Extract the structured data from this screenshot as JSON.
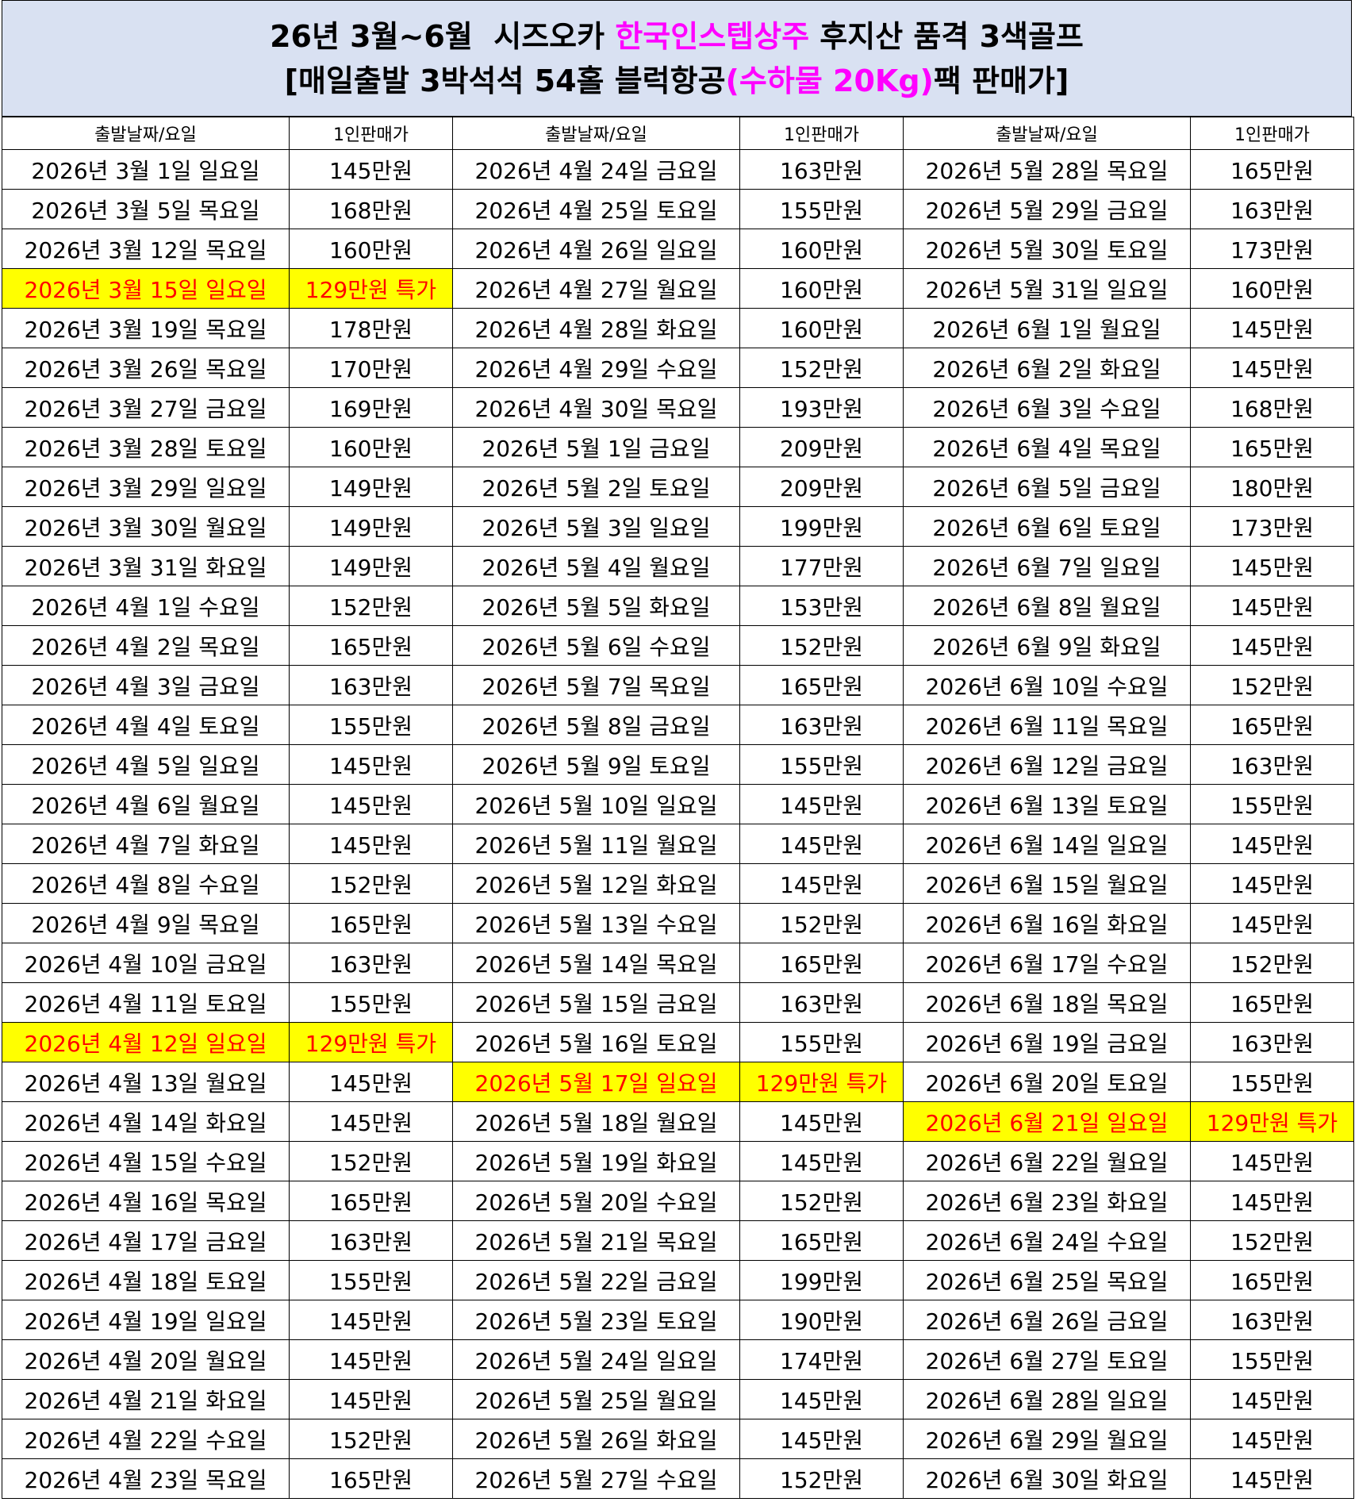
{
  "title": {
    "line1_pre": "26년 3월~6월  시즈오카 ",
    "line1_hl": "한국인스텝상주",
    "line1_post": " 후지산 품격 3색골프",
    "line2_pre": "[매일출발 3박석석 54홀 블럭항공",
    "line2_hl": "(수하물 20Kg)",
    "line2_post": "팩 판매가]"
  },
  "colors": {
    "header_bg": "#d9e1f2",
    "highlight_bg": "#ffff00",
    "highlight_text": "#ff0000",
    "title_accent": "#ff00ff"
  },
  "headers": [
    "출발날짜/요일",
    "1인판매가",
    "출발날짜/요일",
    "1인판매가",
    "출발날짜/요일",
    "1인판매가"
  ],
  "rows": [
    [
      {
        "d": "2026년 3월 1일 일요일",
        "p": "145만원"
      },
      {
        "d": "2026년 4월 24일 금요일",
        "p": "163만원"
      },
      {
        "d": "2026년 5월 28일 목요일",
        "p": "165만원"
      }
    ],
    [
      {
        "d": "2026년 3월 5일 목요일",
        "p": "168만원"
      },
      {
        "d": "2026년 4월 25일 토요일",
        "p": "155만원"
      },
      {
        "d": "2026년 5월 29일 금요일",
        "p": "163만원"
      }
    ],
    [
      {
        "d": "2026년 3월 12일 목요일",
        "p": "160만원"
      },
      {
        "d": "2026년 4월 26일 일요일",
        "p": "160만원"
      },
      {
        "d": "2026년 5월 30일 토요일",
        "p": "173만원"
      }
    ],
    [
      {
        "d": "2026년 3월 15일 일요일",
        "p": "129만원 특가",
        "s": true
      },
      {
        "d": "2026년 4월 27일 월요일",
        "p": "160만원"
      },
      {
        "d": "2026년 5월 31일 일요일",
        "p": "160만원"
      }
    ],
    [
      {
        "d": "2026년 3월 19일 목요일",
        "p": "178만원"
      },
      {
        "d": "2026년 4월 28일 화요일",
        "p": "160만원"
      },
      {
        "d": "2026년 6월 1일 월요일",
        "p": "145만원"
      }
    ],
    [
      {
        "d": "2026년 3월 26일 목요일",
        "p": "170만원"
      },
      {
        "d": "2026년 4월 29일 수요일",
        "p": "152만원"
      },
      {
        "d": "2026년 6월 2일 화요일",
        "p": "145만원"
      }
    ],
    [
      {
        "d": "2026년 3월 27일 금요일",
        "p": "169만원"
      },
      {
        "d": "2026년 4월 30일 목요일",
        "p": "193만원"
      },
      {
        "d": "2026년 6월 3일 수요일",
        "p": "168만원"
      }
    ],
    [
      {
        "d": "2026년 3월 28일 토요일",
        "p": "160만원"
      },
      {
        "d": "2026년 5월 1일 금요일",
        "p": "209만원"
      },
      {
        "d": "2026년 6월 4일 목요일",
        "p": "165만원"
      }
    ],
    [
      {
        "d": "2026년 3월 29일 일요일",
        "p": "149만원"
      },
      {
        "d": "2026년 5월 2일 토요일",
        "p": "209만원"
      },
      {
        "d": "2026년 6월 5일 금요일",
        "p": "180만원"
      }
    ],
    [
      {
        "d": "2026년 3월 30일 월요일",
        "p": "149만원"
      },
      {
        "d": "2026년 5월 3일 일요일",
        "p": "199만원"
      },
      {
        "d": "2026년 6월 6일 토요일",
        "p": "173만원"
      }
    ],
    [
      {
        "d": "2026년 3월 31일 화요일",
        "p": "149만원"
      },
      {
        "d": "2026년 5월 4일 월요일",
        "p": "177만원"
      },
      {
        "d": "2026년 6월 7일 일요일",
        "p": "145만원"
      }
    ],
    [
      {
        "d": "2026년 4월 1일 수요일",
        "p": "152만원"
      },
      {
        "d": "2026년 5월 5일 화요일",
        "p": "153만원"
      },
      {
        "d": "2026년 6월 8일 월요일",
        "p": "145만원"
      }
    ],
    [
      {
        "d": "2026년 4월 2일 목요일",
        "p": "165만원"
      },
      {
        "d": "2026년 5월 6일 수요일",
        "p": "152만원"
      },
      {
        "d": "2026년 6월 9일 화요일",
        "p": "145만원"
      }
    ],
    [
      {
        "d": "2026년 4월 3일 금요일",
        "p": "163만원"
      },
      {
        "d": "2026년 5월 7일 목요일",
        "p": "165만원"
      },
      {
        "d": "2026년 6월 10일 수요일",
        "p": "152만원"
      }
    ],
    [
      {
        "d": "2026년 4월 4일 토요일",
        "p": "155만원"
      },
      {
        "d": "2026년 5월 8일 금요일",
        "p": "163만원"
      },
      {
        "d": "2026년 6월 11일 목요일",
        "p": "165만원"
      }
    ],
    [
      {
        "d": "2026년 4월 5일 일요일",
        "p": "145만원"
      },
      {
        "d": "2026년 5월 9일 토요일",
        "p": "155만원"
      },
      {
        "d": "2026년 6월 12일 금요일",
        "p": "163만원"
      }
    ],
    [
      {
        "d": "2026년 4월 6일 월요일",
        "p": "145만원"
      },
      {
        "d": "2026년 5월 10일 일요일",
        "p": "145만원"
      },
      {
        "d": "2026년 6월 13일 토요일",
        "p": "155만원"
      }
    ],
    [
      {
        "d": "2026년 4월 7일 화요일",
        "p": "145만원"
      },
      {
        "d": "2026년 5월 11일 월요일",
        "p": "145만원"
      },
      {
        "d": "2026년 6월 14일 일요일",
        "p": "145만원"
      }
    ],
    [
      {
        "d": "2026년 4월 8일 수요일",
        "p": "152만원"
      },
      {
        "d": "2026년 5월 12일 화요일",
        "p": "145만원"
      },
      {
        "d": "2026년 6월 15일 월요일",
        "p": "145만원"
      }
    ],
    [
      {
        "d": "2026년 4월 9일 목요일",
        "p": "165만원"
      },
      {
        "d": "2026년 5월 13일 수요일",
        "p": "152만원"
      },
      {
        "d": "2026년 6월 16일 화요일",
        "p": "145만원"
      }
    ],
    [
      {
        "d": "2026년 4월 10일 금요일",
        "p": "163만원"
      },
      {
        "d": "2026년 5월 14일 목요일",
        "p": "165만원"
      },
      {
        "d": "2026년 6월 17일 수요일",
        "p": "152만원"
      }
    ],
    [
      {
        "d": "2026년 4월 11일 토요일",
        "p": "155만원"
      },
      {
        "d": "2026년 5월 15일 금요일",
        "p": "163만원"
      },
      {
        "d": "2026년 6월 18일 목요일",
        "p": "165만원"
      }
    ],
    [
      {
        "d": "2026년 4월 12일 일요일",
        "p": "129만원 특가",
        "s": true
      },
      {
        "d": "2026년 5월 16일 토요일",
        "p": "155만원"
      },
      {
        "d": "2026년 6월 19일 금요일",
        "p": "163만원"
      }
    ],
    [
      {
        "d": "2026년 4월 13일 월요일",
        "p": "145만원"
      },
      {
        "d": "2026년 5월 17일 일요일",
        "p": "129만원 특가",
        "s": true
      },
      {
        "d": "2026년 6월 20일 토요일",
        "p": "155만원"
      }
    ],
    [
      {
        "d": "2026년 4월 14일 화요일",
        "p": "145만원"
      },
      {
        "d": "2026년 5월 18일 월요일",
        "p": "145만원"
      },
      {
        "d": "2026년 6월 21일 일요일",
        "p": "129만원 특가",
        "s": true
      }
    ],
    [
      {
        "d": "2026년 4월 15일 수요일",
        "p": "152만원"
      },
      {
        "d": "2026년 5월 19일 화요일",
        "p": "145만원"
      },
      {
        "d": "2026년 6월 22일 월요일",
        "p": "145만원"
      }
    ],
    [
      {
        "d": "2026년 4월 16일 목요일",
        "p": "165만원"
      },
      {
        "d": "2026년 5월 20일 수요일",
        "p": "152만원"
      },
      {
        "d": "2026년 6월 23일 화요일",
        "p": "145만원"
      }
    ],
    [
      {
        "d": "2026년 4월 17일 금요일",
        "p": "163만원"
      },
      {
        "d": "2026년 5월 21일 목요일",
        "p": "165만원"
      },
      {
        "d": "2026년 6월 24일 수요일",
        "p": "152만원"
      }
    ],
    [
      {
        "d": "2026년 4월 18일 토요일",
        "p": "155만원"
      },
      {
        "d": "2026년 5월 22일 금요일",
        "p": "199만원"
      },
      {
        "d": "2026년 6월 25일 목요일",
        "p": "165만원"
      }
    ],
    [
      {
        "d": "2026년 4월 19일 일요일",
        "p": "145만원"
      },
      {
        "d": "2026년 5월 23일 토요일",
        "p": "190만원"
      },
      {
        "d": "2026년 6월 26일 금요일",
        "p": "163만원"
      }
    ],
    [
      {
        "d": "2026년 4월 20일 월요일",
        "p": "145만원"
      },
      {
        "d": "2026년 5월 24일 일요일",
        "p": "174만원"
      },
      {
        "d": "2026년 6월 27일 토요일",
        "p": "155만원"
      }
    ],
    [
      {
        "d": "2026년 4월 21일 화요일",
        "p": "145만원"
      },
      {
        "d": "2026년 5월 25일 월요일",
        "p": "145만원"
      },
      {
        "d": "2026년 6월 28일 일요일",
        "p": "145만원"
      }
    ],
    [
      {
        "d": "2026년 4월 22일 수요일",
        "p": "152만원"
      },
      {
        "d": "2026년 5월 26일 화요일",
        "p": "145만원"
      },
      {
        "d": "2026년 6월 29일 월요일",
        "p": "145만원"
      }
    ],
    [
      {
        "d": "2026년 4월 23일 목요일",
        "p": "165만원"
      },
      {
        "d": "2026년 5월 27일 수요일",
        "p": "152만원"
      },
      {
        "d": "2026년 6월 30일 화요일",
        "p": "145만원"
      }
    ]
  ]
}
